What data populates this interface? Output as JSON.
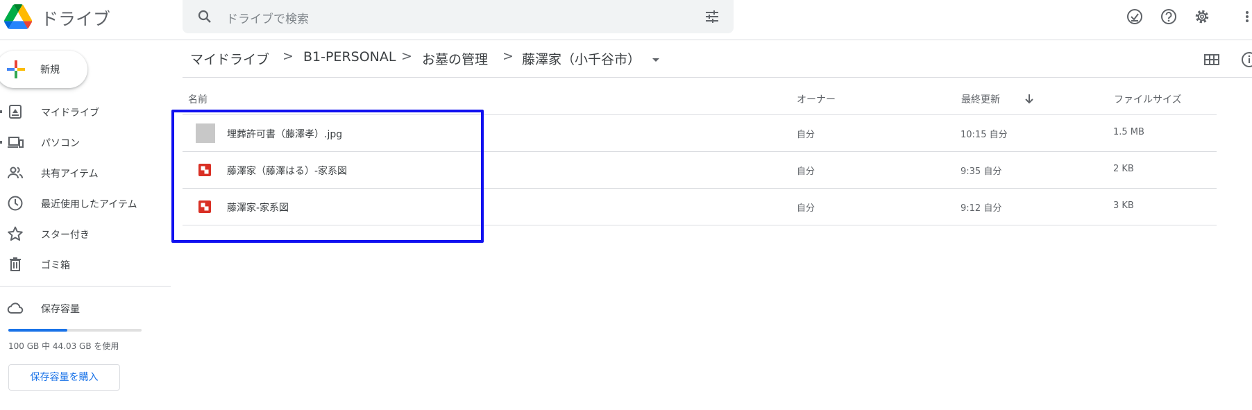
{
  "app": {
    "title": "ドライブ"
  },
  "search": {
    "placeholder": "ドライブで検索"
  },
  "header_icons": [
    "offline-check-icon",
    "help-icon",
    "settings-icon",
    "apps-icon"
  ],
  "new_button": {
    "label": "新規"
  },
  "nav": {
    "items": [
      {
        "label": "マイドライブ",
        "icon": "my-drive-icon",
        "expandable": true
      },
      {
        "label": "パソコン",
        "icon": "computers-icon",
        "expandable": true
      },
      {
        "label": "共有アイテム",
        "icon": "shared-icon",
        "expandable": false
      },
      {
        "label": "最近使用したアイテム",
        "icon": "recent-icon",
        "expandable": false
      },
      {
        "label": "スター付き",
        "icon": "star-icon",
        "expandable": false
      },
      {
        "label": "ゴミ箱",
        "icon": "trash-icon",
        "expandable": false
      }
    ],
    "storage": {
      "label": "保存容量",
      "usage_text": "100 GB 中 44.03 GB を使用",
      "used_fraction": 0.4403,
      "buy_label": "保存容量を購入"
    }
  },
  "breadcrumb": {
    "items": [
      "マイドライブ",
      "B1-PERSONAL",
      "お墓の管理",
      "藤澤家（小千谷市）"
    ],
    "separator": ">"
  },
  "table": {
    "headers": {
      "name": "名前",
      "owner": "オーナー",
      "modified": "最終更新",
      "size": "ファイルサイズ"
    },
    "sort": "modified-descending",
    "rows": [
      {
        "name": "埋葬許可書（藤澤孝）.jpg",
        "owner": "自分",
        "modified": "10:15 自分",
        "size": "1.5 MB",
        "type": "image"
      },
      {
        "name": "藤澤家（藤澤はる）-家系図",
        "owner": "自分",
        "modified": "9:35 自分",
        "size": "2 KB",
        "type": "drawing"
      },
      {
        "name": "藤澤家-家系図",
        "owner": "自分",
        "modified": "9:12 自分",
        "size": "3 KB",
        "type": "drawing"
      }
    ]
  },
  "colors": {
    "accent": "#1a73e8",
    "highlight": "#1010f0",
    "drawing_icon": "#d93025"
  }
}
